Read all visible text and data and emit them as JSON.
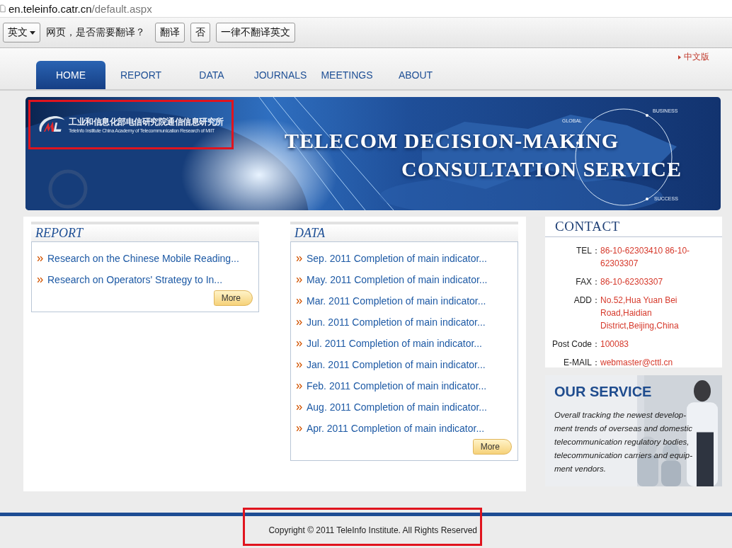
{
  "browser": {
    "url_host": "en.teleinfo.catr.cn",
    "url_path": "/default.aspx"
  },
  "translate_bar": {
    "language": "英文",
    "prompt": "网页，是否需要翻译？",
    "buttons": [
      "翻译",
      "否",
      "一律不翻译英文"
    ]
  },
  "language_link": "中文版",
  "nav": [
    {
      "label": "HOME",
      "selected": true
    },
    {
      "label": "REPORT",
      "selected": false
    },
    {
      "label": "DATA",
      "selected": false
    },
    {
      "label": "JOURNALS",
      "selected": false
    },
    {
      "label": "MEETINGS",
      "selected": false
    },
    {
      "label": "ABOUT",
      "selected": false
    }
  ],
  "banner": {
    "org_name_cn": "工业和信息化部电信研究院通信信息研究所",
    "org_name_en": "TeleInfo Institute China Academy of Telecommunication Research of MIIT",
    "highlight": true,
    "headline": [
      "TELECOM DECISION-MAKING",
      "CONSULTATION SERVICE"
    ],
    "orbit_labels": [
      "GLOBAL",
      "BUSINESS",
      "SUCCESS"
    ]
  },
  "report": {
    "title": "REPORT",
    "items": [
      "Research on the Chinese Mobile Reading...",
      "Research on Operators' Strategy to In..."
    ],
    "more": "More"
  },
  "data": {
    "title": "DATA",
    "items": [
      "Sep. 2011 Completion of main indicator...",
      "May. 2011 Completion of main indicator...",
      "Mar. 2011 Completion of main indicator...",
      "Jun. 2011 Completion of main indicator...",
      "Jul. 2011 Completion of main indicator...",
      "Jan. 2011 Completion of main indicator...",
      "Feb. 2011 Completion of main indicator...",
      "Aug. 2011 Completion of main indicator...",
      "Apr. 2011 Completion of main indicator..."
    ],
    "more": "More"
  },
  "contact": {
    "title": "CONTACT",
    "rows": [
      {
        "label": "TEL：",
        "value": "86-10-62303410 86-10-62303307"
      },
      {
        "label": "FAX：",
        "value": "86-10-62303307"
      },
      {
        "label": "ADD：",
        "value": "No.52,Hua Yuan Bei Road,Haidian District,Beijing,China"
      },
      {
        "label": "Post Code：",
        "value": "100083"
      },
      {
        "label": "E-MAIL：",
        "value": "webmaster@cttl.cn"
      }
    ]
  },
  "service": {
    "title": "OUR SERVICE",
    "text": "Overall tracking the newest develop-\nment trends of overseas and domestic\ntelecommunication regulatory bodies,\ntelecommunication carriers and equip-\nment vendors."
  },
  "footer": {
    "copyright": "Copyright © 2011 TeleInfo Institute. All Rights Reserved",
    "highlight": true
  }
}
